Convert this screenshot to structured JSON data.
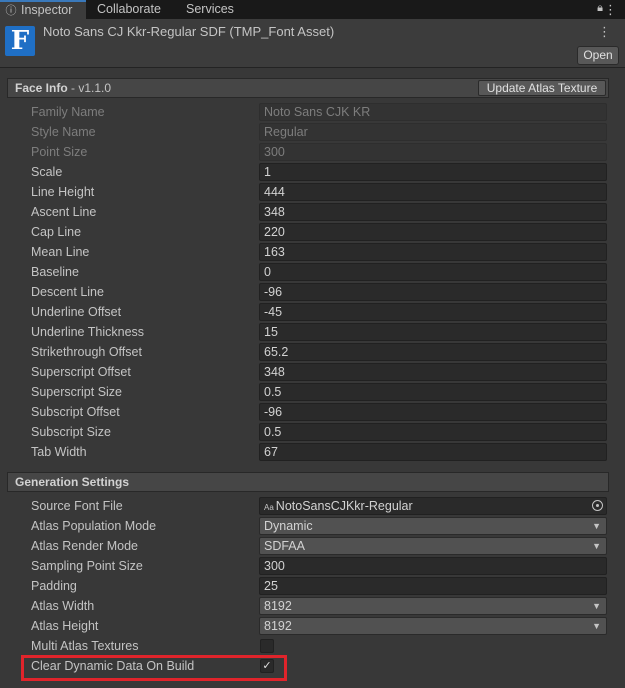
{
  "tabs": {
    "inspector": "Inspector",
    "collaborate": "Collaborate",
    "services": "Services"
  },
  "header": {
    "icon_letter": "F",
    "title": "Noto Sans CJ Kkr-Regular SDF (TMP_Font Asset)",
    "open_button": "Open"
  },
  "face_info": {
    "title": "Face Info",
    "version": "- v1.1.0",
    "update_button": "Update Atlas Texture",
    "rows": [
      {
        "label": "Family Name",
        "value": "Noto Sans CJK KR",
        "disabled": true
      },
      {
        "label": "Style Name",
        "value": "Regular",
        "disabled": true
      },
      {
        "label": "Point Size",
        "value": "300",
        "disabled": true
      },
      {
        "label": "Scale",
        "value": "1"
      },
      {
        "label": "Line Height",
        "value": "444"
      },
      {
        "label": "Ascent Line",
        "value": "348"
      },
      {
        "label": "Cap Line",
        "value": "220"
      },
      {
        "label": "Mean Line",
        "value": "163"
      },
      {
        "label": "Baseline",
        "value": "0"
      },
      {
        "label": "Descent Line",
        "value": "-96"
      },
      {
        "label": "Underline Offset",
        "value": "-45"
      },
      {
        "label": "Underline Thickness",
        "value": "15"
      },
      {
        "label": "Strikethrough Offset",
        "value": "65.2"
      },
      {
        "label": "Superscript Offset",
        "value": "348"
      },
      {
        "label": "Superscript Size",
        "value": "0.5"
      },
      {
        "label": "Subscript Offset",
        "value": "-96"
      },
      {
        "label": "Subscript Size",
        "value": "0.5"
      },
      {
        "label": "Tab Width",
        "value": "67"
      }
    ]
  },
  "generation": {
    "title": "Generation Settings",
    "source_font_file": {
      "label": "Source Font File",
      "value": "NotoSansCJKkr-Regular"
    },
    "atlas_population_mode": {
      "label": "Atlas Population Mode",
      "value": "Dynamic"
    },
    "atlas_render_mode": {
      "label": "Atlas Render Mode",
      "value": "SDFAA"
    },
    "sampling_point_size": {
      "label": "Sampling Point Size",
      "value": "300"
    },
    "padding": {
      "label": "Padding",
      "value": "25"
    },
    "atlas_width": {
      "label": "Atlas Width",
      "value": "8192"
    },
    "atlas_height": {
      "label": "Atlas Height",
      "value": "8192"
    },
    "multi_atlas_textures": {
      "label": "Multi Atlas Textures",
      "checked": false
    },
    "clear_dynamic_data": {
      "label": "Clear Dynamic Data On Build",
      "checked": true
    }
  },
  "colors": {
    "highlight": "#e0242b",
    "accent": "#3a79bb",
    "background": "#383838"
  }
}
